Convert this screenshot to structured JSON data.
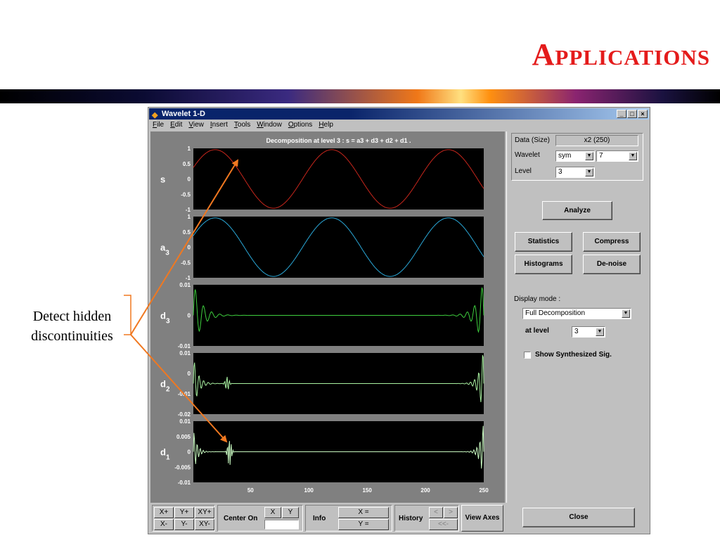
{
  "slide": {
    "title": "Applications",
    "side_label_line1": "Detect hidden",
    "side_label_line2": "discontinuities",
    "accent_color": "#e41b1b",
    "arrow_color": "#f07820"
  },
  "window": {
    "title": "Wavelet 1-D",
    "controls": [
      "_",
      "□",
      "×"
    ],
    "menu": [
      "File",
      "Edit",
      "View",
      "Insert",
      "Tools",
      "Window",
      "Options",
      "Help"
    ]
  },
  "plot": {
    "title": "Decomposition at level 3 : s = a3 + d3 + d2 + d1 .",
    "x_ticks": [
      "50",
      "100",
      "150",
      "200",
      "250"
    ],
    "panels": [
      {
        "name": "s",
        "sub": "",
        "yticks": [
          "1",
          "0.5",
          "0",
          "-0.5",
          "-1"
        ],
        "color": "#c8261c",
        "kind": "sine"
      },
      {
        "name": "a",
        "sub": "3",
        "yticks": [
          "1",
          "0.5",
          "0",
          "-0.5",
          "-1"
        ],
        "color": "#2aa8d8",
        "kind": "sine"
      },
      {
        "name": "d",
        "sub": "3",
        "yticks": [
          "0.01",
          "0",
          "-0.01"
        ],
        "color": "#3ecf3e",
        "kind": "d3"
      },
      {
        "name": "d",
        "sub": "2",
        "yticks": [
          "0.01",
          "0",
          "-0.01",
          "-0.02"
        ],
        "color": "#a8f0a0",
        "kind": "d2"
      },
      {
        "name": "d",
        "sub": "1",
        "yticks": [
          "0.01",
          "0.005",
          "0",
          "-0.005",
          "-0.01"
        ],
        "color": "#c8f8c0",
        "kind": "d1"
      }
    ]
  },
  "panel": {
    "data_label": "Data  (Size)",
    "data_value": "x2  (250)",
    "wavelet_label": "Wavelet",
    "wavelet_family": "sym",
    "wavelet_order": "7",
    "level_label": "Level",
    "level_value": "3",
    "analyze": "Analyze",
    "statistics": "Statistics",
    "compress": "Compress",
    "histograms": "Histograms",
    "denoise": "De-noise",
    "display_mode_label": "Display mode :",
    "display_mode_value": "Full Decomposition",
    "at_level_label": "at level",
    "at_level_value": "3",
    "show_synth": "Show Synthesized Sig.",
    "close": "Close"
  },
  "toolbar": {
    "zoom_buttons": [
      "X+",
      "Y+",
      "XY+",
      "X-",
      "Y-",
      "XY-"
    ],
    "center_on": "Center On",
    "x_btn": "X",
    "y_btn": "Y",
    "info": "Info",
    "x_eq": "X =",
    "y_eq": "Y =",
    "history": "History",
    "hist_prev": "<",
    "hist_next": ">",
    "hist_first": "<<-",
    "view_axes": "View Axes"
  }
}
